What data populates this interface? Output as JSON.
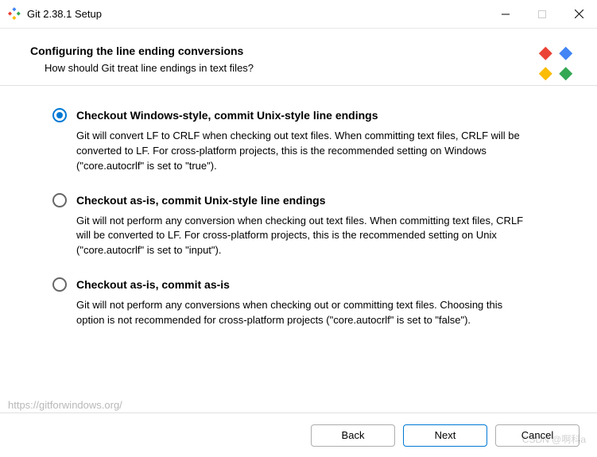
{
  "window": {
    "title": "Git 2.38.1 Setup"
  },
  "header": {
    "title": "Configuring the line ending conversions",
    "subtitle": "How should Git treat line endings in text files?"
  },
  "options": [
    {
      "selected": true,
      "title": "Checkout Windows-style, commit Unix-style line endings",
      "desc": "Git will convert LF to CRLF when checking out text files. When committing text files, CRLF will be converted to LF. For cross-platform projects, this is the recommended setting on Windows (\"core.autocrlf\" is set to \"true\")."
    },
    {
      "selected": false,
      "title": "Checkout as-is, commit Unix-style line endings",
      "desc": "Git will not perform any conversion when checking out text files. When committing text files, CRLF will be converted to LF. For cross-platform projects, this is the recommended setting on Unix (\"core.autocrlf\" is set to \"input\")."
    },
    {
      "selected": false,
      "title": "Checkout as-is, commit as-is",
      "desc": "Git will not perform any conversions when checking out or committing text files. Choosing this option is not recommended for cross-platform projects (\"core.autocrlf\" is set to \"false\")."
    }
  ],
  "footer": {
    "link": "https://gitforwindows.org/",
    "back": "Back",
    "next": "Next",
    "cancel": "Cancel"
  },
  "watermark": "CSDN @啊科a"
}
